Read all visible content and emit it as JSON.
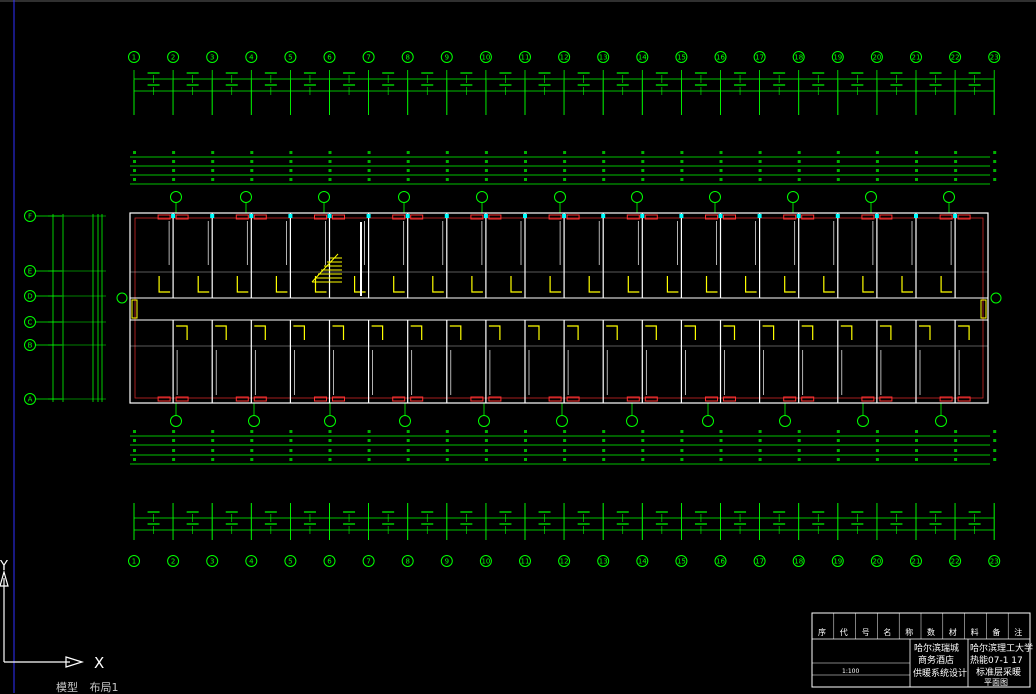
{
  "grid_axes_top": [
    "1",
    "2",
    "3",
    "4",
    "5",
    "6",
    "7",
    "8",
    "9",
    "10",
    "11",
    "12",
    "13",
    "14",
    "15",
    "16",
    "17",
    "18",
    "19",
    "20",
    "21",
    "22",
    "23"
  ],
  "grid_axes_bottom": [
    "1",
    "2",
    "3",
    "4",
    "5",
    "6",
    "7",
    "8",
    "9",
    "10",
    "11",
    "12",
    "13",
    "14",
    "15",
    "16",
    "17",
    "18",
    "19",
    "20",
    "21",
    "22",
    "23"
  ],
  "grid_axes_left": [
    "F",
    "E",
    "D",
    "C",
    "B",
    "A"
  ],
  "title_block": {
    "header": [
      "序",
      "代",
      "号",
      "名",
      "称",
      "数",
      "材",
      "料",
      "备",
      "注"
    ],
    "client_1": "哈尔滨瑞城",
    "client_2": "商务酒店",
    "design_type": "供暖系统设计",
    "university": "哈尔滨理工大学",
    "drawing_no": "热能07-1 17",
    "drawing_title_1": "标准层采暖",
    "drawing_title_2": "平面图",
    "scale_label": "1:100"
  },
  "ucs": {
    "y_label": "Y",
    "x_label": "X"
  },
  "layout_tabs": [
    "模型",
    "布局1"
  ],
  "colors": {
    "background": "#000000",
    "dimension": "#00ff00",
    "wall": "#ffffff",
    "pipe": "#ffff00",
    "radiator": "#ff3030",
    "riser": "#00ffff"
  }
}
